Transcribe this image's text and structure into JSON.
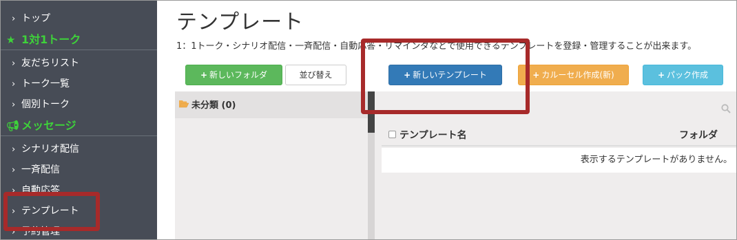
{
  "sidebar": {
    "items": [
      {
        "id": "top",
        "label": "トップ",
        "type": "item"
      },
      {
        "id": "talk-section",
        "label": "1対1トーク",
        "type": "section",
        "icon": "star-icon"
      },
      {
        "id": "friends",
        "label": "友だちリスト",
        "type": "item"
      },
      {
        "id": "talk-list",
        "label": "トーク一覧",
        "type": "item"
      },
      {
        "id": "individual-talk",
        "label": "個別トーク",
        "type": "item"
      },
      {
        "id": "message-section",
        "label": "メッセージ",
        "type": "section",
        "icon": "megaphone-icon"
      },
      {
        "id": "scenario",
        "label": "シナリオ配信",
        "type": "item"
      },
      {
        "id": "broadcast",
        "label": "一斉配信",
        "type": "item"
      },
      {
        "id": "auto-reply",
        "label": "自動応答",
        "type": "item"
      },
      {
        "id": "template",
        "label": "テンプレート",
        "type": "item"
      },
      {
        "id": "reservation",
        "label": "予約管理",
        "type": "item"
      }
    ]
  },
  "main": {
    "title": "テンプレート",
    "description": "1：1トーク・シナリオ配信・一斉配信・自動応答・リマインダなどで使用できるテンプレートを登録・管理することが出来ます。",
    "buttons": {
      "new_folder": "新しいフォルダ",
      "sort": "並び替え",
      "new_template": "新しいテンプレート",
      "carousel": "カルーセル作成(新)",
      "pack": "パック作成"
    },
    "folder": {
      "name": "未分類 (0)"
    },
    "table": {
      "columns": [
        "テンプレート名",
        "フォルダ"
      ],
      "empty_message": "表示するテンプレートがありません。"
    }
  },
  "colors": {
    "sidebar_bg": "#474c56",
    "section_green": "#3ed23a",
    "primary": "#337ab7",
    "success": "#5cb85c",
    "warning": "#f0ad4e",
    "info": "#5bc0de",
    "annotation": "#a72a2a"
  }
}
